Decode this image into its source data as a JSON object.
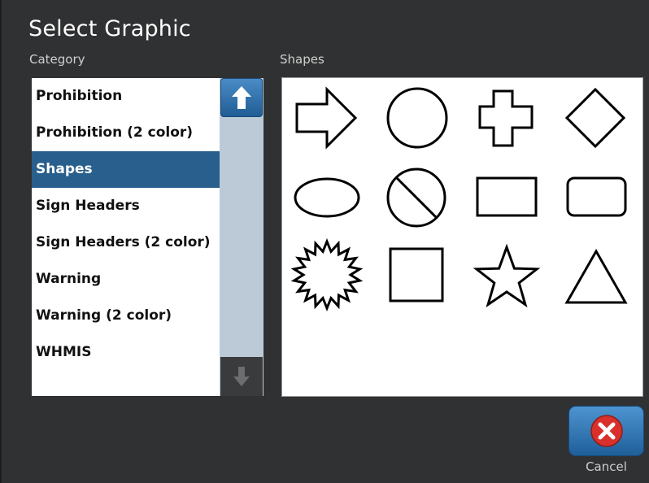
{
  "dialog": {
    "title": "Select Graphic",
    "category_label": "Category",
    "shapes_label": "Shapes",
    "cancel_label": "Cancel"
  },
  "categories": [
    {
      "label": "Prohibition",
      "selected": false
    },
    {
      "label": "Prohibition (2 color)",
      "selected": false
    },
    {
      "label": "Shapes",
      "selected": true
    },
    {
      "label": "Sign Headers",
      "selected": false
    },
    {
      "label": "Sign Headers (2 color)",
      "selected": false
    },
    {
      "label": "Warning",
      "selected": false
    },
    {
      "label": "Warning (2 color)",
      "selected": false
    },
    {
      "label": "WHMIS",
      "selected": false
    }
  ],
  "shapes": [
    "arrow-right",
    "circle",
    "cross",
    "diamond",
    "ellipse",
    "prohibition",
    "rectangle",
    "rounded-rectangle",
    "starburst",
    "square",
    "star",
    "triangle"
  ],
  "icons": {
    "scroll_up": "arrow-up-icon",
    "scroll_down": "arrow-down-icon",
    "cancel": "close-icon"
  },
  "colors": {
    "selected_row": "#285f8c",
    "button_blue": "#2a6fae",
    "cancel_red": "#d9302c"
  }
}
